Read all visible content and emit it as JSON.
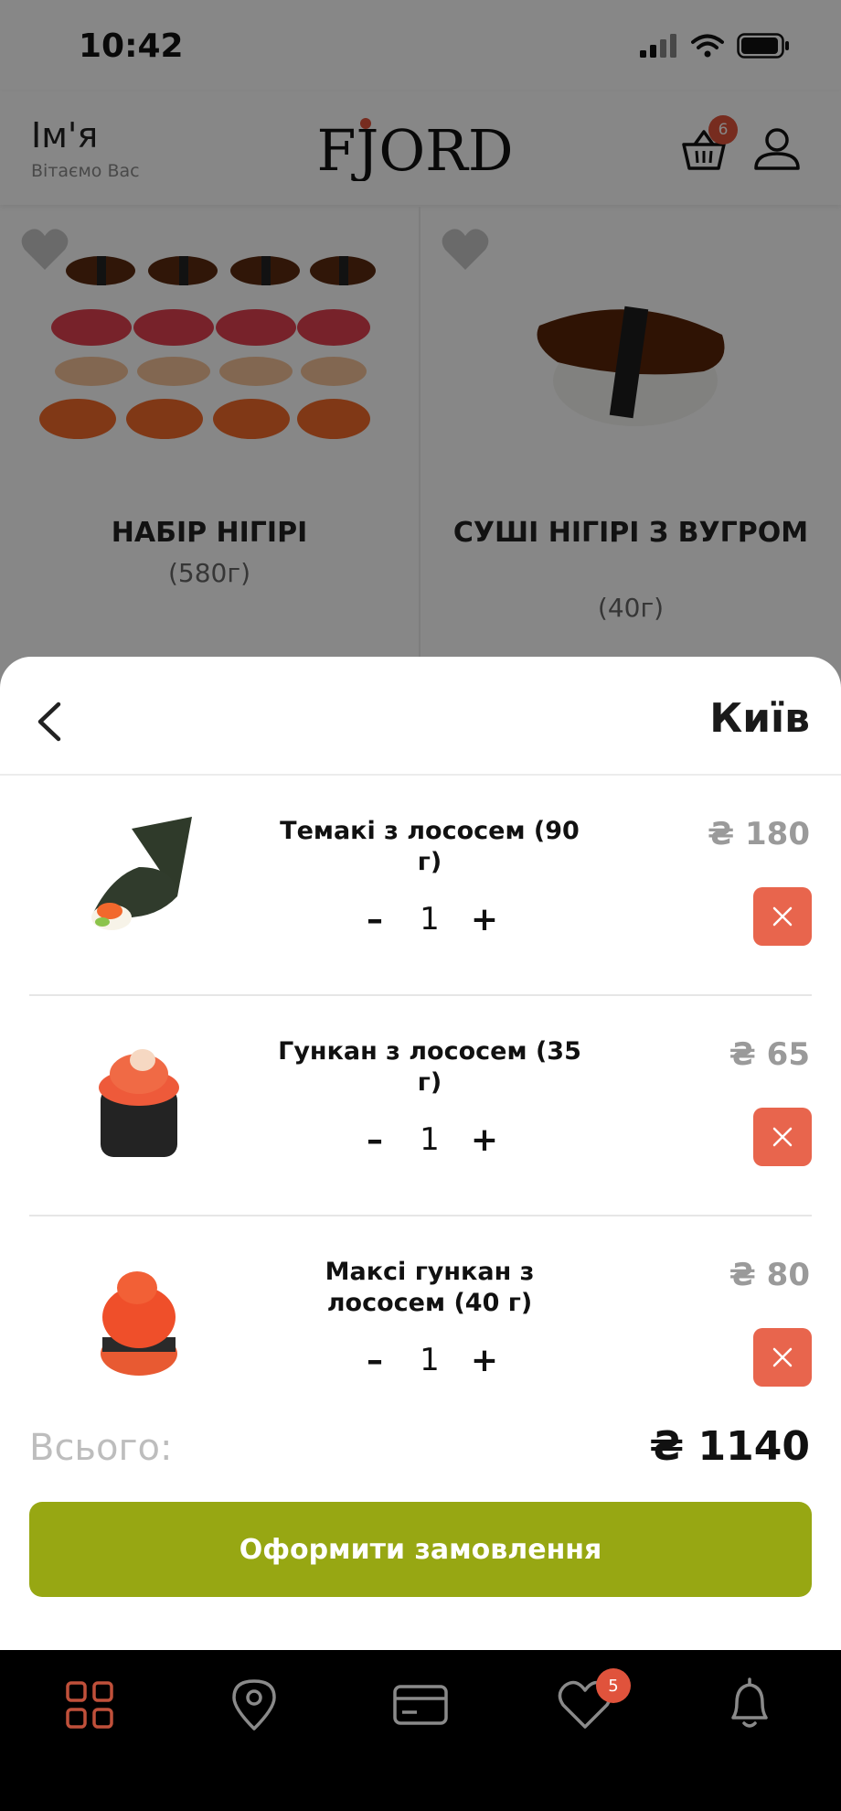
{
  "status_bar": {
    "time": "10:42"
  },
  "header": {
    "user_name": "Ім'я",
    "greeting": "Вітаємо Вас",
    "logo_text": "FJORD",
    "cart_badge": "6"
  },
  "products": [
    {
      "title": "НАБІР НІГІРІ",
      "weight": "(580г)"
    },
    {
      "title": "СУШІ НІГІРІ З ВУГРОМ",
      "weight": "(40г)"
    }
  ],
  "sheet": {
    "city": "Київ",
    "items": [
      {
        "name": "Темакі з лососем (90 г)",
        "qty": "1",
        "price": "₴ 180",
        "minus": "–",
        "plus": "+"
      },
      {
        "name": "Гункан з лососем (35 г)",
        "qty": "1",
        "price": "₴ 65",
        "minus": "–",
        "plus": "+"
      },
      {
        "name": "Максі гункан з лососем (40 г)",
        "qty": "1",
        "price": "₴ 80",
        "minus": "–",
        "plus": "+"
      }
    ],
    "total_label": "Всього:",
    "total_value": "₴ 1140",
    "checkout_label": "Оформити замовлення"
  },
  "bottom_nav": {
    "items": [
      "menu-grid-icon",
      "location-pin-icon",
      "payment-card-icon",
      "favorites-heart-icon",
      "notifications-bell-icon"
    ],
    "favorites_badge": "5"
  },
  "colors": {
    "accent_green": "#97a713",
    "remove_red": "#e8654d",
    "badge_red": "#e0533c",
    "nav_active": "#c0503a"
  }
}
